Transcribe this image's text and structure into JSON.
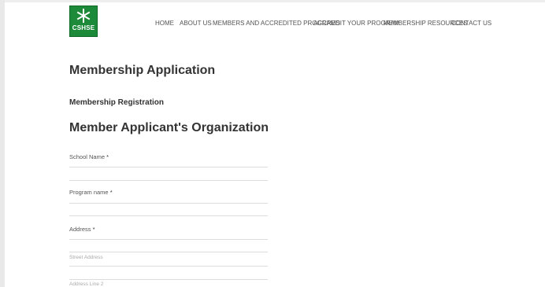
{
  "header": {
    "logo_text": "CSHSE",
    "nav": [
      "HOME",
      "ABOUT US",
      "MEMBERS AND ACCREDITED PROGRAMS",
      "ACCREDIT YOUR PROGRAM",
      "MEMBERSHIP RESOURCES",
      "CONTACT US"
    ]
  },
  "page": {
    "title": "Membership Application",
    "subtitle": "Membership Registration",
    "section_title": "Member Applicant's Organization"
  },
  "form": {
    "school_name_label": "School Name",
    "program_name_label": "Program name",
    "address_label": "Address",
    "required_mark": "*",
    "street_address_placeholder": "Street Address",
    "address_line2_placeholder": "Address Line 2"
  },
  "colors": {
    "brand_green": "#1d8a3a"
  }
}
